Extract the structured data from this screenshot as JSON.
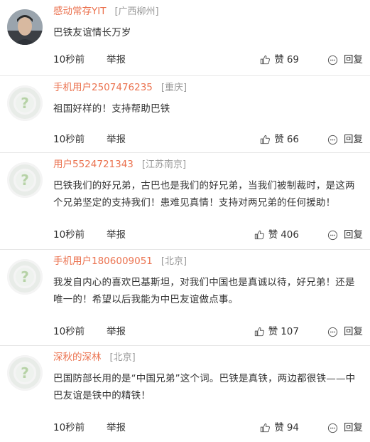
{
  "comments": [
    {
      "user": "感动常存YIT",
      "location": "[广西柳州]",
      "avatar": "photo",
      "content": "巴铁友谊情长万岁",
      "time": "10秒前",
      "report": "举报",
      "like_label": "赞",
      "likes": "69",
      "reply": "回复"
    },
    {
      "user": "手机用户2507476235",
      "location": "[重庆]",
      "avatar": "default",
      "content": "祖国好样的！支持帮助巴铁",
      "time": "10秒前",
      "report": "举报",
      "like_label": "赞",
      "likes": "66",
      "reply": "回复"
    },
    {
      "user": "用户5524721343",
      "location": "[江苏南京]",
      "avatar": "default",
      "content": "巴铁我们的好兄弟，古巴也是我们的好兄弟，当我们被制裁时，是这两个兄弟坚定的支持我们！患难见真情！支持对两兄弟的任何援助！",
      "time": "10秒前",
      "report": "举报",
      "like_label": "赞",
      "likes": "406",
      "reply": "回复"
    },
    {
      "user": "手机用户1806009051",
      "location": "[北京]",
      "avatar": "default",
      "content": "我发自内心的喜欢巴基斯坦，对我们中国也是真诚以待，好兄弟！还是唯一的！希望以后我能为中巴友谊做点事。",
      "time": "10秒前",
      "report": "举报",
      "like_label": "赞",
      "likes": "107",
      "reply": "回复"
    },
    {
      "user": "深秋的深林",
      "location": "[北京]",
      "avatar": "default",
      "content": "巴国防部长用的是“中国兄弟”这个词。巴铁是真铁，两边都很铁——中巴友谊是铁中的精铁！",
      "time": "10秒前",
      "report": "举报",
      "like_label": "赞",
      "likes": "94",
      "reply": "回复"
    }
  ],
  "colors": {
    "username": "#eb7350",
    "location": "#999999",
    "text": "#333333",
    "divider": "#e6e6e6"
  }
}
